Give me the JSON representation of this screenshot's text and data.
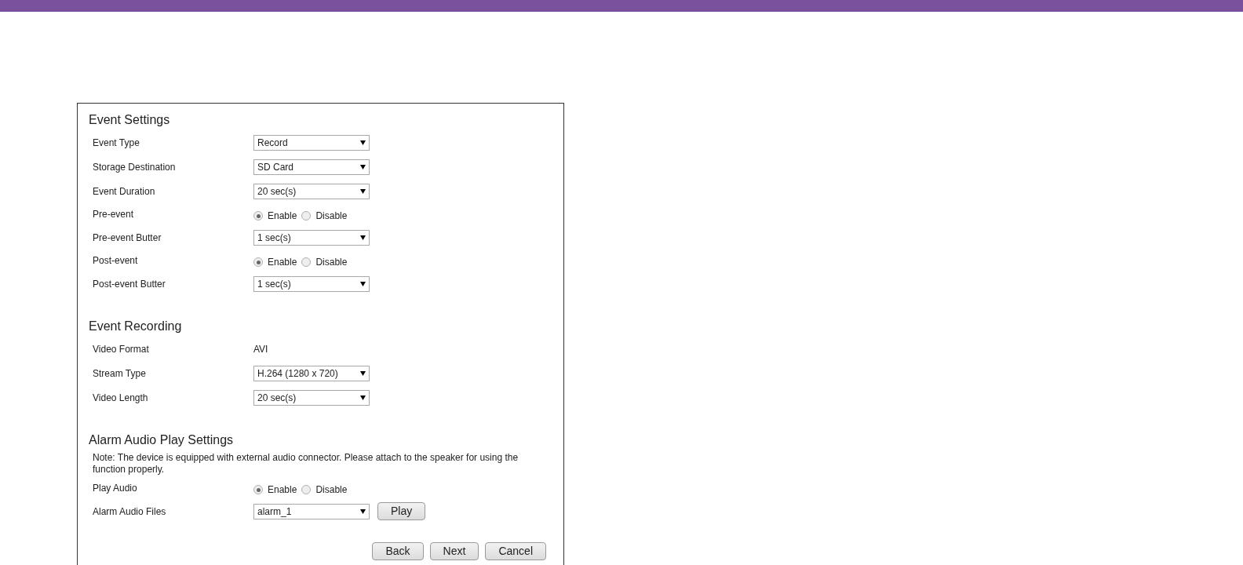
{
  "sections": [
    {
      "title": "Event Settings",
      "rows": [
        {
          "kind": "select",
          "label": "Event Type",
          "value": "Record"
        },
        {
          "kind": "select",
          "label": "Storage Destination",
          "value": "SD Card"
        },
        {
          "kind": "select",
          "label": "Event Duration",
          "value": "20 sec(s)"
        },
        {
          "kind": "radio",
          "label": "Pre-event",
          "options": [
            {
              "label": "Enable",
              "selected": true
            },
            {
              "label": "Disable",
              "selected": false
            }
          ]
        },
        {
          "kind": "select",
          "label": "Pre-event Butter",
          "value": "1 sec(s)"
        },
        {
          "kind": "radio",
          "label": "Post-event",
          "options": [
            {
              "label": "Enable",
              "selected": true
            },
            {
              "label": "Disable",
              "selected": false
            }
          ]
        },
        {
          "kind": "select",
          "label": "Post-event Butter",
          "value": "1 sec(s)"
        }
      ]
    },
    {
      "title": "Event Recording",
      "rows": [
        {
          "kind": "text",
          "label": "Video Format",
          "value": "AVI"
        },
        {
          "kind": "select",
          "label": "Stream Type",
          "value": "H.264 (1280 x 720)"
        },
        {
          "kind": "select",
          "label": "Video Length",
          "value": "20 sec(s)"
        }
      ]
    },
    {
      "title": "Alarm Audio Play Settings",
      "note": "Note: The device is equipped with external audio connector. Please attach to the speaker for using the function properly.",
      "rows": [
        {
          "kind": "radio",
          "label": "Play Audio",
          "options": [
            {
              "label": "Enable",
              "selected": true
            },
            {
              "label": "Disable",
              "selected": false
            }
          ]
        },
        {
          "kind": "select",
          "label": "Alarm Audio Files",
          "value": "alarm_1",
          "button": "Play"
        }
      ]
    }
  ],
  "buttons": [
    "Back",
    "Next",
    "Cancel"
  ]
}
